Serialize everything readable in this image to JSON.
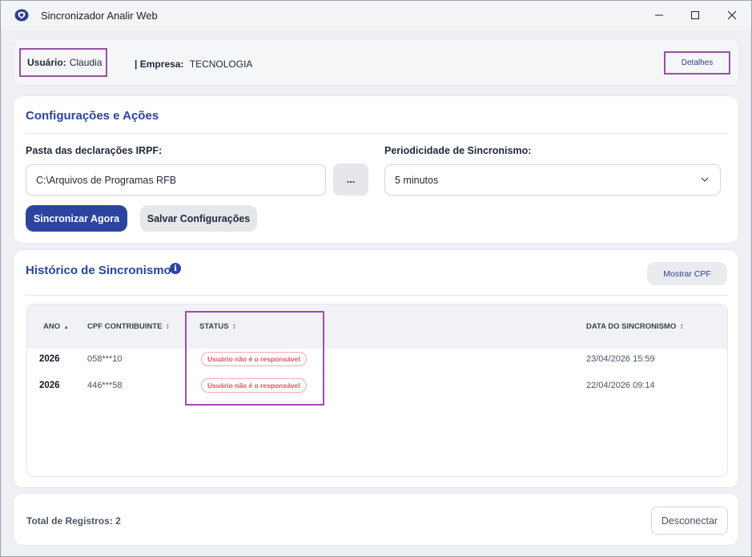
{
  "window": {
    "title": "Sincronizador Analir Web",
    "icons": {
      "app": "shield-logo-icon",
      "minimize": "minimize-icon",
      "maximize": "maximize-icon",
      "close": "close-icon"
    }
  },
  "user_bar": {
    "user_label": "Usuário:",
    "user_name": "Claudia",
    "company_label": "| Empresa:",
    "company_name": "TECNOLOGIA",
    "details_button": "Detalhes"
  },
  "config": {
    "title": "Configurações e Ações",
    "folder_label": "Pasta das declarações IRPF:",
    "folder_value": "C:\\Arquivos de Programas RFB",
    "browse_button": "...",
    "period_label": "Periodicidade de Sincronismo:",
    "period_value": "5 minutos",
    "sync_button": "Sincronizar Agora",
    "save_button": "Salvar Configurações"
  },
  "history": {
    "title": "Histórico de Sincronismo",
    "info_icon": "info-icon",
    "show_cpf_button": "Mostrar CPF",
    "columns": {
      "year": "ANO",
      "year_sort": "▲",
      "cpf": "CPF CONTRIBUINTE",
      "status": "STATUS",
      "date": "DATA DO SINCRONISMO",
      "sort_icon": "↕"
    },
    "rows": [
      {
        "year": "2026",
        "cpf": "058***10",
        "status": "Usuário não é o responsável",
        "date": "23/04/2026 15:59"
      },
      {
        "year": "2026",
        "cpf": "446***58",
        "status": "Usuário não é o responsável",
        "date": "22/04/2026 09:14"
      }
    ]
  },
  "footer": {
    "total_label": "Total de Registros: 2",
    "disconnect_button": "Desconectar"
  },
  "colors": {
    "accent": "#2a44a0",
    "highlight": "#9a4fa5",
    "error": "#e05260"
  }
}
